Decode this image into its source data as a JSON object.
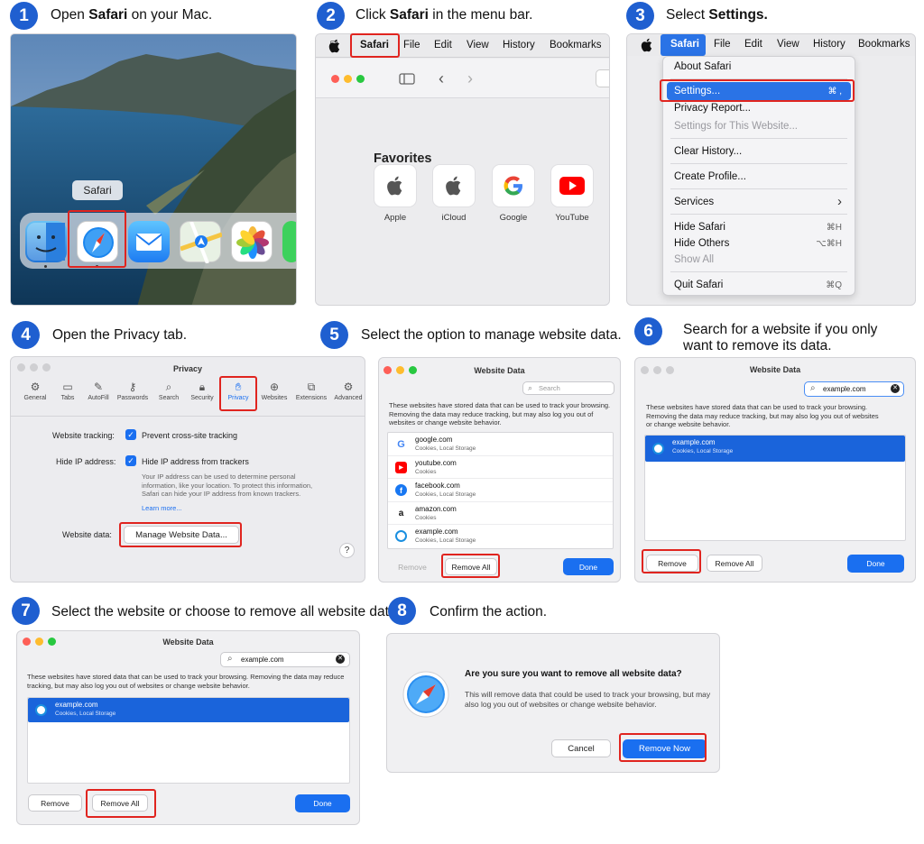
{
  "steps": [
    {
      "num": "1",
      "pre": "Open ",
      "bold": "Safari",
      "post": " on your Mac."
    },
    {
      "num": "2",
      "pre": "Click ",
      "bold": "Safari",
      "post": " in the menu bar."
    },
    {
      "num": "3",
      "pre": "Select ",
      "bold": "Settings.",
      "post": ""
    },
    {
      "num": "4",
      "pre": "Open the Privacy tab.",
      "bold": "",
      "post": ""
    },
    {
      "num": "5",
      "pre": "Select the option to manage website data.",
      "bold": "",
      "post": ""
    },
    {
      "num": "6",
      "pre": "Search for a website if you only want to remove its data.",
      "bold": "",
      "post": ""
    },
    {
      "num": "7",
      "pre": "Select the website or choose to remove all website data.",
      "bold": "",
      "post": ""
    },
    {
      "num": "8",
      "pre": "Confirm the action.",
      "bold": "",
      "post": ""
    }
  ],
  "dock": {
    "tooltip": "Safari"
  },
  "menubar": {
    "items": [
      "Safari",
      "File",
      "Edit",
      "View",
      "History",
      "Bookmarks"
    ]
  },
  "favorites": {
    "title": "Favorites",
    "items": [
      "Apple",
      "iCloud",
      "Google",
      "YouTube"
    ]
  },
  "safari_menu": {
    "items": [
      {
        "label": "About Safari",
        "key": ""
      },
      {
        "label": "Settings...",
        "key": "⌘ ,"
      },
      {
        "label": "Privacy Report...",
        "key": ""
      },
      {
        "label": "Settings for This Website...",
        "key": ""
      },
      {
        "label": "Clear History...",
        "key": ""
      },
      {
        "label": "Create Profile...",
        "key": ""
      },
      {
        "label": "Services",
        "key": "›"
      },
      {
        "label": "Hide Safari",
        "key": "⌘H"
      },
      {
        "label": "Hide Others",
        "key": "⌥⌘H"
      },
      {
        "label": "Show All",
        "key": ""
      },
      {
        "label": "Quit Safari",
        "key": "⌘Q"
      }
    ]
  },
  "privacy": {
    "title": "Privacy",
    "tabs": [
      "General",
      "Tabs",
      "AutoFill",
      "Passwords",
      "Search",
      "Security",
      "Privacy",
      "Websites",
      "Extensions",
      "Advanced"
    ],
    "tracking_label": "Website tracking:",
    "tracking_value": "Prevent cross-site tracking",
    "hideip_label": "Hide IP address:",
    "hideip_value": "Hide IP address from trackers",
    "info": "Your IP address can be used to determine personal information, like your location. To protect this information, Safari can hide your IP address from known trackers.",
    "learn": "Learn more...",
    "data_label": "Website data:",
    "manage_btn": "Manage Website Data...",
    "help": "?"
  },
  "website_data": {
    "title": "Website Data",
    "search_placeholder": "Search",
    "search_value": "example.com",
    "desc": "These websites have stored data that can be used to track your browsing. Removing the data may reduce tracking, but may also log you out of websites or change website behavior.",
    "sites": [
      {
        "name": "google.com",
        "detail": "Cookies, Local Storage"
      },
      {
        "name": "youtube.com",
        "detail": "Cookies"
      },
      {
        "name": "facebook.com",
        "detail": "Cookies, Local Storage"
      },
      {
        "name": "amazon.com",
        "detail": "Cookies"
      },
      {
        "name": "example.com",
        "detail": "Cookies, Local Storage"
      }
    ],
    "remove": "Remove",
    "remove_all": "Remove All",
    "done": "Done"
  },
  "confirm": {
    "title": "Are you sure you want to remove all website data?",
    "body": "This will remove data that could be used to track your browsing, but may also log you out of websites or change website behavior.",
    "cancel": "Cancel",
    "ok": "Remove Now"
  },
  "colors": {
    "accent": "#1a6ff0",
    "highlight": "#e0241f",
    "badge": "#1f5fd0"
  }
}
